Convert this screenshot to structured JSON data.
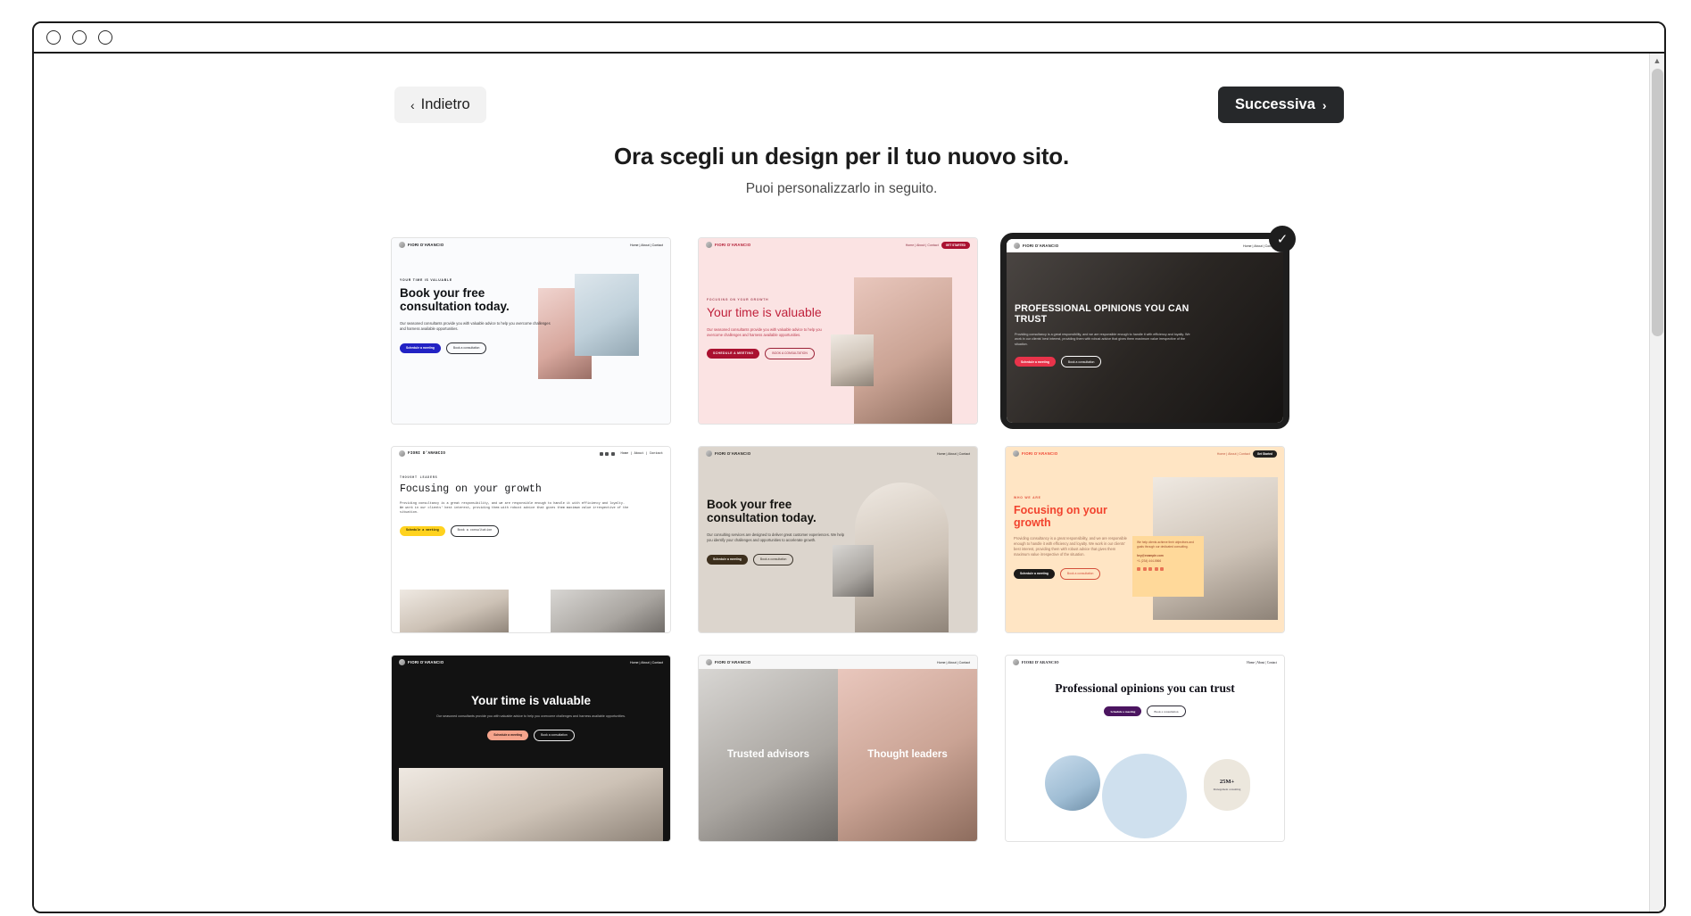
{
  "window": {
    "traffic_lights": [
      "close-dot",
      "minimize-dot",
      "maximize-dot"
    ]
  },
  "scrollbar": {
    "up_arrow": "▲"
  },
  "toolbar": {
    "back_label": "Indietro",
    "back_chevron": "‹",
    "next_label": "Successiva",
    "next_chevron": "›"
  },
  "heading": {
    "title": "Ora scegli un design per il tuo nuovo sito.",
    "subtitle": "Puoi personalizzarlo in seguito."
  },
  "selection": {
    "selected_index": 2,
    "check_glyph": "✓",
    "accent_color": "#1e1e1e"
  },
  "templates": [
    {
      "theme": "t1",
      "brand": "FIORI D'ARANCIO",
      "nav_links": "Home | About | Contact",
      "eyebrow": "YOUR TIME IS VALUABLE",
      "headline": "Book your free consultation today.",
      "body": "Our seasoned consultants provide you with valuable advice to help you overcome challenges and harness available opportunities.",
      "cta_primary": "Schedule a meeting",
      "cta_secondary": "Book a consultation",
      "accent": "#2222c4"
    },
    {
      "theme": "t2",
      "brand": "FIORI D'ARANCIO",
      "nav_links": "Home | About | Contact",
      "nav_pill": "GET STARTED",
      "eyebrow": "FOCUSING ON YOUR GROWTH",
      "headline": "Your time is valuable",
      "body": "Our seasoned consultants provide you with valuable advice to help you overcome challenges and harness available opportunities.",
      "cta_primary": "SCHEDULE A MEETING",
      "cta_secondary": "BOOK A CONSULTATION",
      "accent": "#aa1130"
    },
    {
      "theme": "t3",
      "brand": "FIORI D'ARANCIO",
      "nav_links": "Home | About | Contact",
      "headline": "PROFESSIONAL OPINIONS YOU CAN TRUST",
      "body": "Providing consultancy is a great responsibility, and we are responsible enough to handle it with efficiency and loyalty. We work in our clients' best interest, providing them with robust advice that gives them maximum value irrespective of the situation.",
      "cta_primary": "Schedule a meeting",
      "cta_secondary": "Book a consultation",
      "accent": "#e8334a"
    },
    {
      "theme": "t4",
      "brand": "FIORI D'ARANCIO",
      "nav_links": "Home | About | Contact",
      "eyebrow": "THOUGHT LEADERS",
      "headline": "Focusing on your growth",
      "body": "Providing consultancy is a great responsibility, and we are responsible enough to handle it with efficiency and loyalty. We work in our clients' best interest, providing them with robust advice that gives them maximum value irrespective of the situation.",
      "cta_primary": "Schedule a meeting",
      "cta_secondary": "Book a consultation",
      "accent": "#ffd21e"
    },
    {
      "theme": "t5",
      "brand": "FIORI D'ARANCIO",
      "nav_links": "Home | About | Contact",
      "headline": "Book your free consultation today.",
      "body": "Our consulting services are designed to deliver great customer experiences. We help you identify your challenges and opportunities to accelerate growth.",
      "cta_primary": "Schedule a meeting",
      "cta_secondary": "Book a consultation",
      "accent": "#3d2f1d"
    },
    {
      "theme": "t6",
      "brand": "FIORI D'ARANCIO",
      "nav_links": "Home | About | Contact",
      "nav_pill": "Get Started",
      "eyebrow": "WHO WE ARE",
      "headline": "Focusing on your growth",
      "body": "Providing consultancy is a great responsibility, and we are responsible enough to handle it with efficiency and loyalty. We work in our clients' best interest, providing them with robust advice that gives them maximum value irrespective of the situation.",
      "cta_primary": "Schedule a meeting",
      "cta_secondary": "Book a consultation",
      "card_text": "We help clients achieve their objectives and goals through our dedicated consulting.",
      "card_email": "hey@example.com",
      "card_phone": "+1 (234) 444-5566",
      "accent": "#f2432e"
    },
    {
      "theme": "t7",
      "brand": "FIORI D'ARANCIO",
      "nav_links": "Home | About | Contact",
      "headline": "Your time is valuable",
      "body": "Our seasoned consultants provide you with valuable advice to help you overcome challenges and harness available opportunities.",
      "cta_primary": "Schedule a meeting",
      "cta_secondary": "Book a consultation",
      "accent": "#f5a48c"
    },
    {
      "theme": "t8",
      "brand": "FIORI D'ARANCIO",
      "nav_links": "Home | About | Contact",
      "overlay_left": "Trusted advisors",
      "overlay_right": "Thought leaders",
      "accent": "#ffffff"
    },
    {
      "theme": "t9",
      "brand": "FIORI D'ARANCIO",
      "nav_links": "Home | About | Contact",
      "headline": "Professional opinions you can trust",
      "cta_primary": "Schedule a meeting",
      "cta_secondary": "Book a consultation",
      "stat_value": "25M+",
      "stat_label": "Management consulting",
      "accent": "#4b1560"
    }
  ]
}
